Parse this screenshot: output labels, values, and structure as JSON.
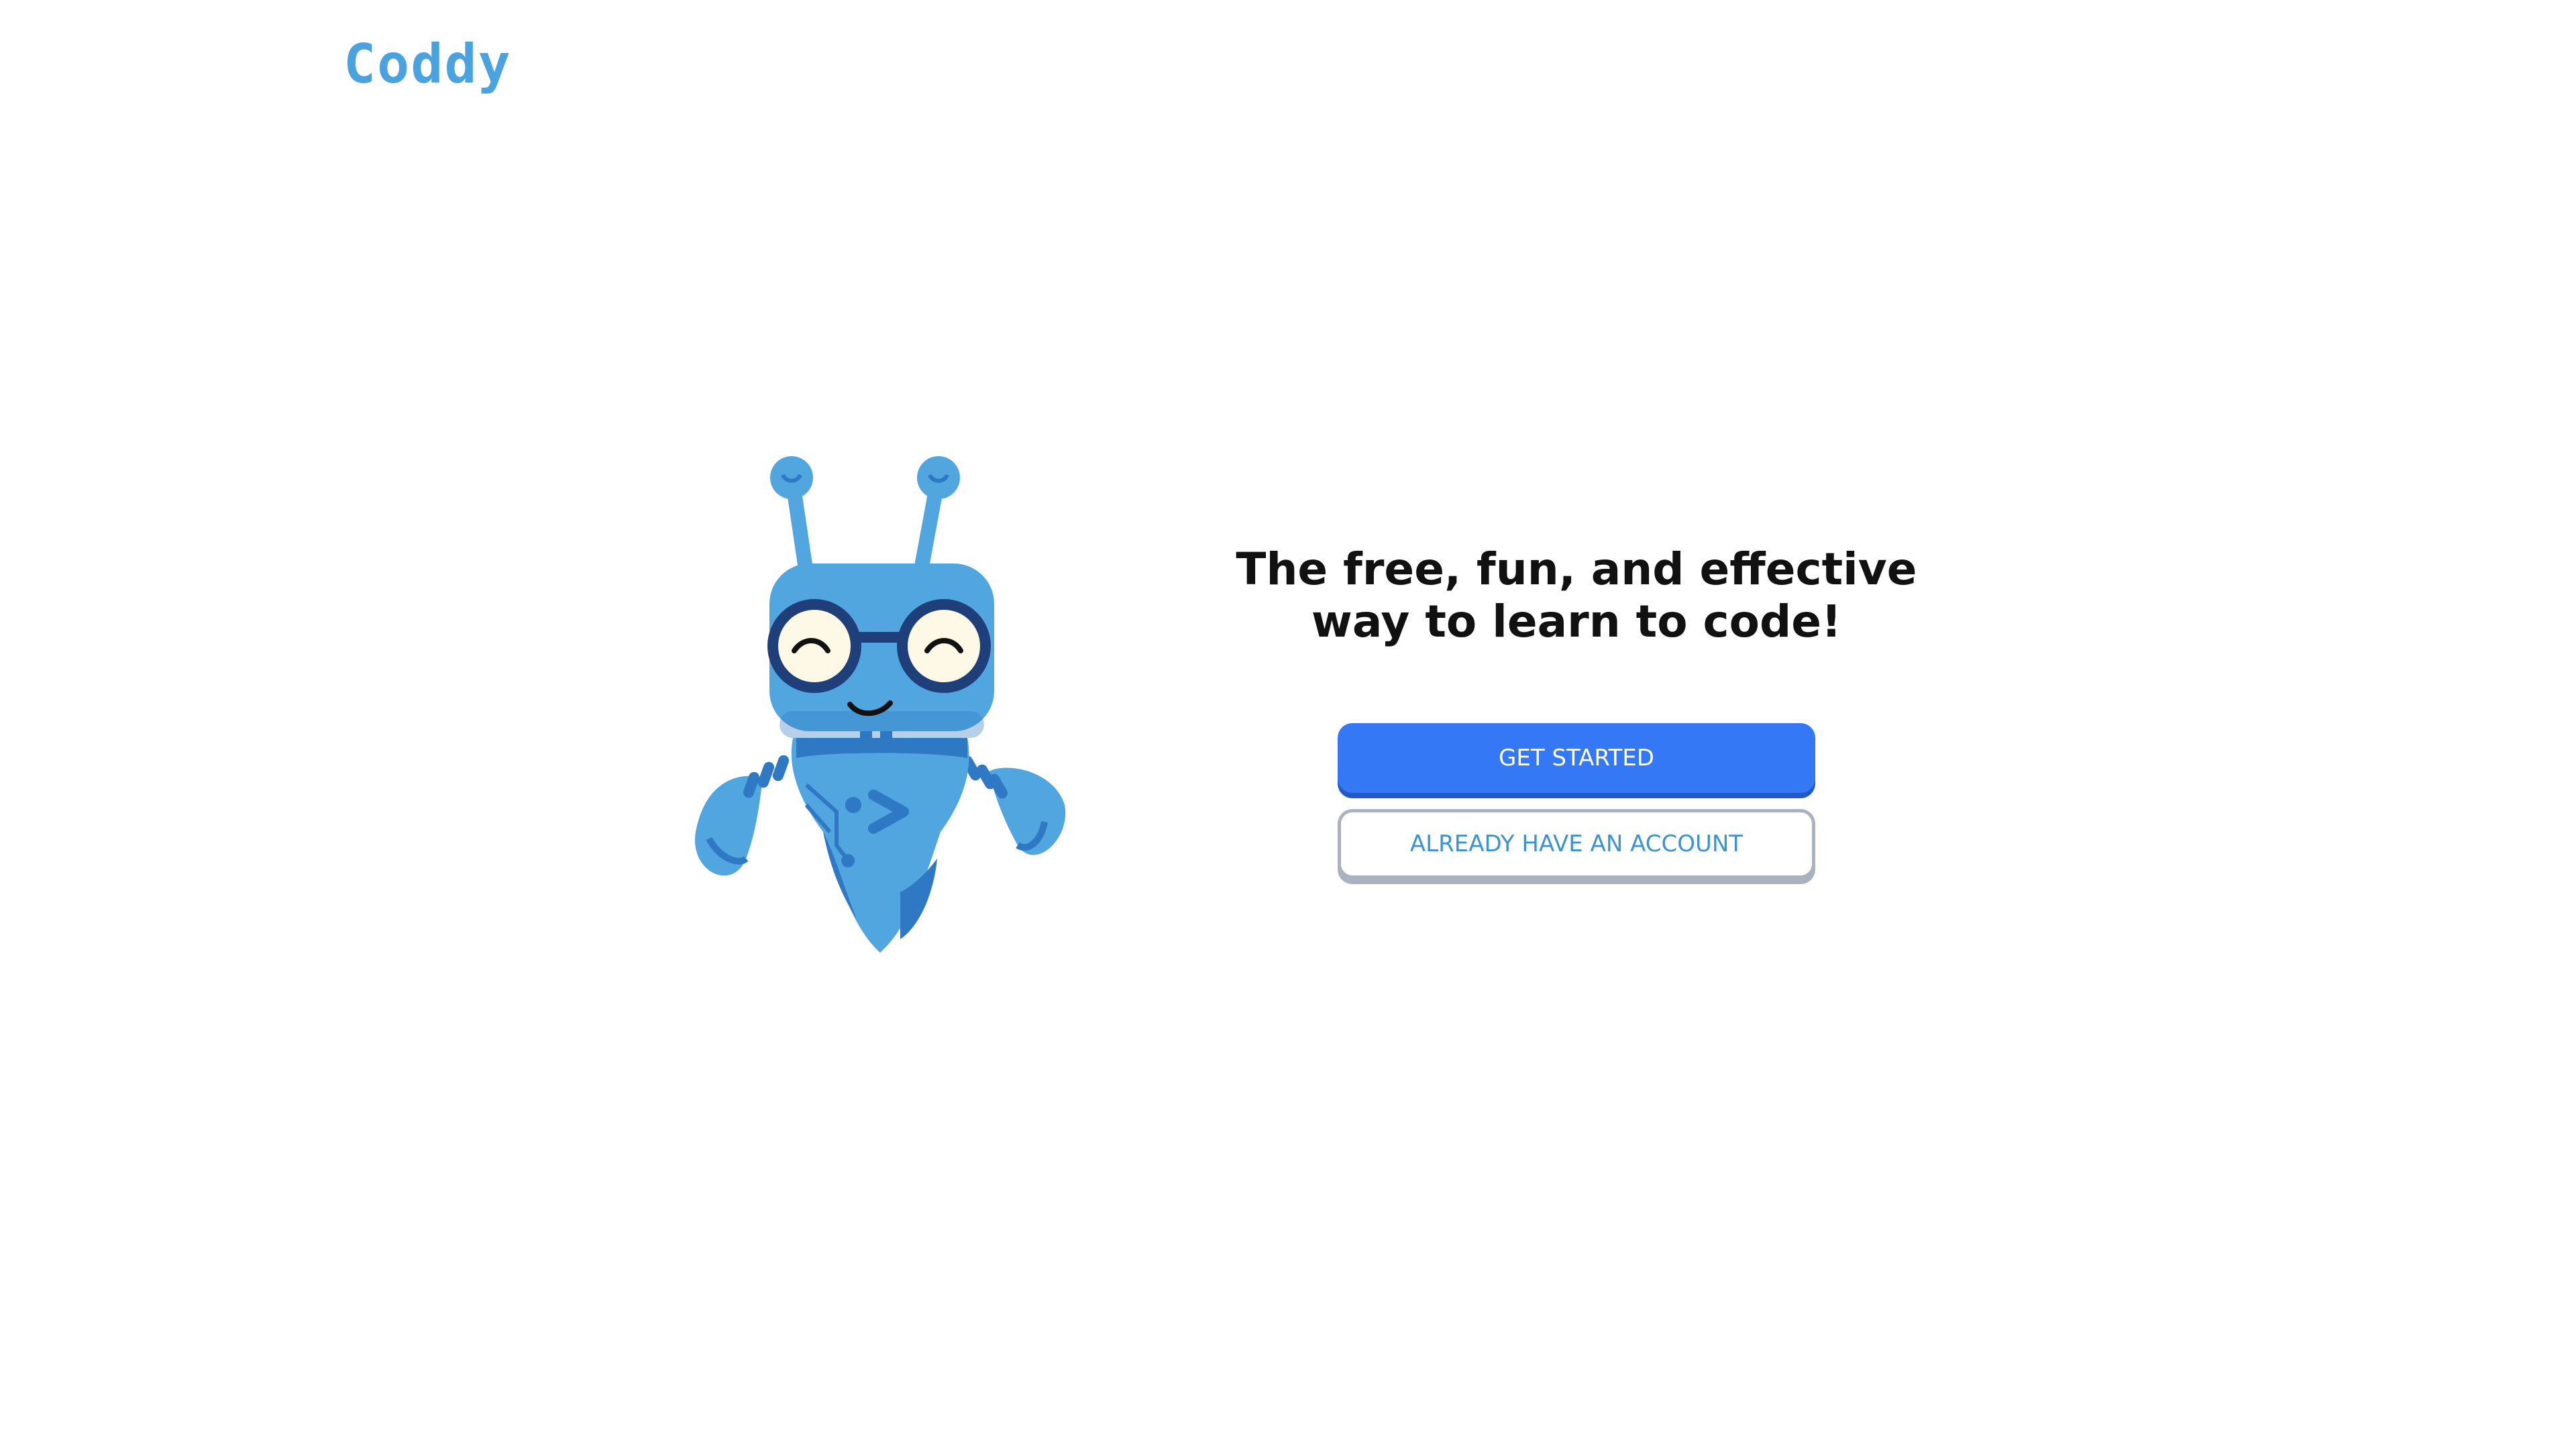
{
  "brand": {
    "logo_text": "Coddy",
    "color": "#4aa3df"
  },
  "hero": {
    "headline": "The free, fun, and effective way to learn to code!",
    "primary_button": "GET STARTED",
    "secondary_button": "ALREADY HAVE AN ACCOUNT"
  },
  "mascot": {
    "icon": "robot-mascot-icon",
    "body_color": "#52a6df",
    "dark_color": "#2f78c4",
    "glasses_color": "#1e3f7a"
  },
  "colors": {
    "primary": "#3578f6",
    "secondary_text": "#3a93d6",
    "text": "#111111"
  }
}
